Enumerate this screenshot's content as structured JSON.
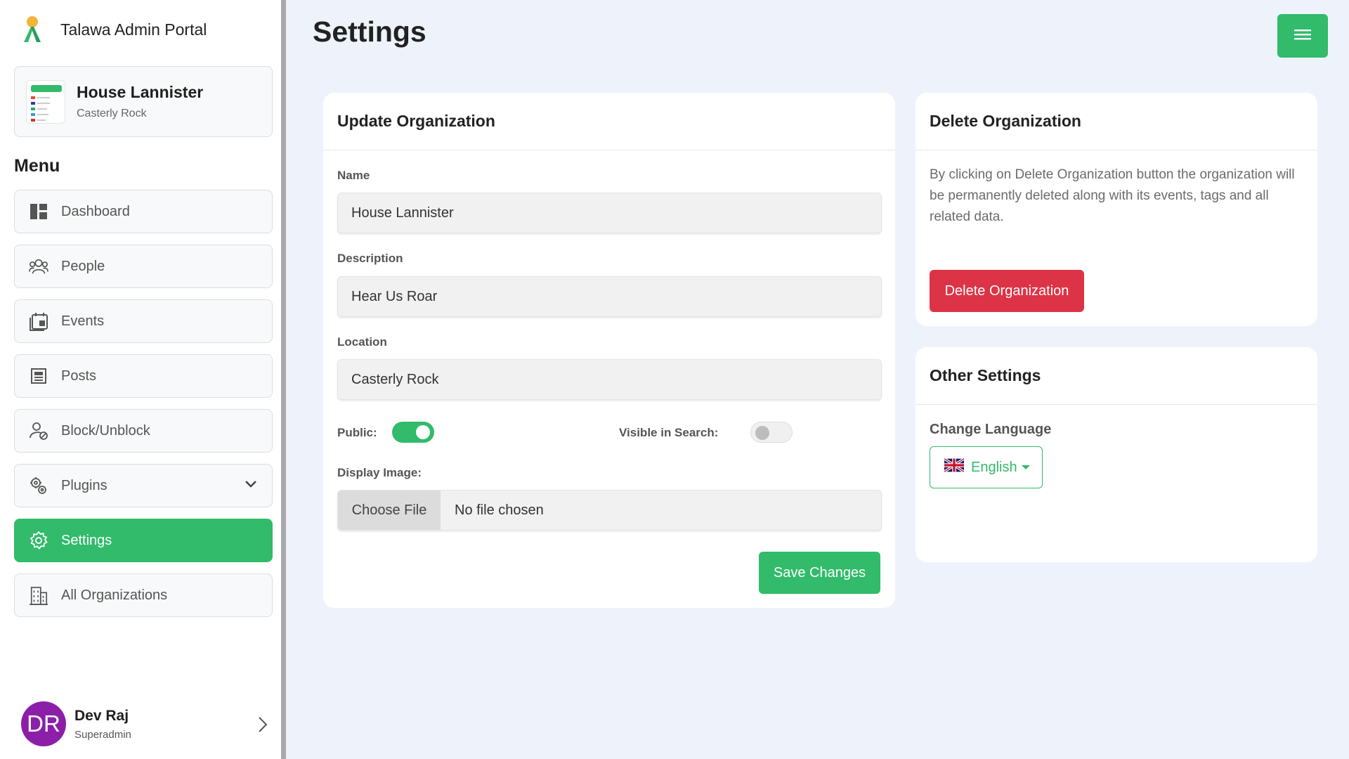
{
  "app": {
    "title": "Talawa Admin Portal"
  },
  "organization": {
    "name": "House Lannister",
    "location": "Casterly Rock"
  },
  "menu": {
    "title": "Menu",
    "items": [
      {
        "label": "Dashboard",
        "icon": "dashboard-icon"
      },
      {
        "label": "People",
        "icon": "people-icon"
      },
      {
        "label": "Events",
        "icon": "events-icon"
      },
      {
        "label": "Posts",
        "icon": "posts-icon"
      },
      {
        "label": "Block/Unblock",
        "icon": "block-user-icon"
      },
      {
        "label": "Plugins",
        "icon": "plugins-icon"
      },
      {
        "label": "Settings",
        "icon": "gear-icon",
        "active": true
      },
      {
        "label": "All Organizations",
        "icon": "building-icon"
      }
    ]
  },
  "user": {
    "initials": "DR",
    "name": "Dev Raj",
    "role": "Superadmin"
  },
  "page": {
    "title": "Settings"
  },
  "update_org": {
    "heading": "Update Organization",
    "name_label": "Name",
    "name_value": "House Lannister",
    "description_label": "Description",
    "description_value": "Hear Us Roar",
    "location_label": "Location",
    "location_value": "Casterly Rock",
    "public_label": "Public:",
    "public_on": true,
    "visible_label": "Visible in Search:",
    "visible_on": false,
    "display_image_label": "Display Image:",
    "choose_file_label": "Choose File",
    "no_file_text": "No file chosen",
    "save_label": "Save Changes"
  },
  "delete_org": {
    "heading": "Delete Organization",
    "description": "By clicking on Delete Organization button the organization will be permanently deleted along with its events, tags and all related data.",
    "button_label": "Delete Organization"
  },
  "other_settings": {
    "heading": "Other Settings",
    "change_language_label": "Change Language",
    "language_value": "English"
  },
  "colors": {
    "accent": "#31bb6b",
    "danger": "#dd3346",
    "avatar": "#8c1fa8",
    "background": "#eef3fb"
  }
}
